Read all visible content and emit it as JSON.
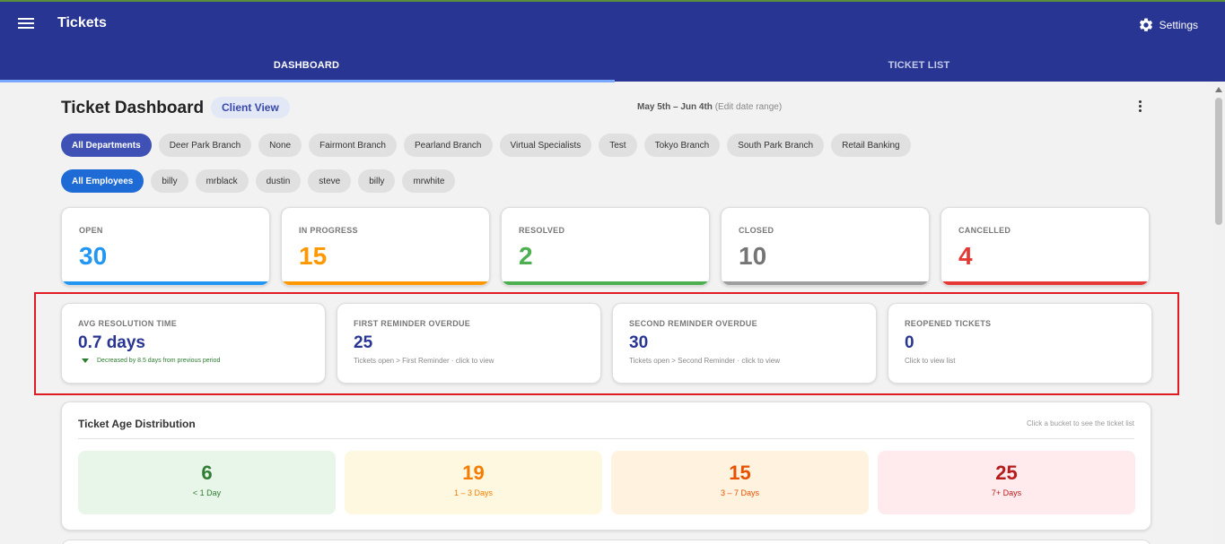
{
  "app": {
    "title": "Tickets",
    "settings_label": "Settings"
  },
  "tabs": [
    {
      "label": "DASHBOARD",
      "active": true
    },
    {
      "label": "TICKET LIST",
      "active": false
    }
  ],
  "header": {
    "title": "Ticket Dashboard",
    "client_view_label": "Client View",
    "date_range": "May 5th – Jun 4th",
    "edit_date_range": "(Edit date range)"
  },
  "departments": [
    {
      "label": "All Departments",
      "selected": true
    },
    {
      "label": "Deer Park Branch"
    },
    {
      "label": "None"
    },
    {
      "label": "Fairmont Branch"
    },
    {
      "label": "Pearland Branch"
    },
    {
      "label": "Virtual Specialists"
    },
    {
      "label": "Test"
    },
    {
      "label": "Tokyo Branch"
    },
    {
      "label": "South Park Branch"
    },
    {
      "label": "Retail Banking"
    }
  ],
  "employees": [
    {
      "label": "All Employees",
      "selected": true
    },
    {
      "label": "billy"
    },
    {
      "label": "mrblack"
    },
    {
      "label": "dustin"
    },
    {
      "label": "steve"
    },
    {
      "label": "billy"
    },
    {
      "label": "mrwhite"
    }
  ],
  "status_cards": [
    {
      "label": "OPEN",
      "value": "30",
      "color": "#2196f3"
    },
    {
      "label": "IN PROGRESS",
      "value": "15",
      "color": "#ff9800"
    },
    {
      "label": "RESOLVED",
      "value": "2",
      "color": "#4caf50"
    },
    {
      "label": "CLOSED",
      "value": "10",
      "color": "#757575"
    },
    {
      "label": "CANCELLED",
      "value": "4",
      "color": "#e53935"
    }
  ],
  "kpis": {
    "avg_resolution": {
      "label": "AVG RESOLUTION TIME",
      "value": "0.7 days",
      "trend": "Decreased by 8.5 days from previous period"
    },
    "first_reminder": {
      "label": "FIRST REMINDER OVERDUE",
      "value": "25",
      "sub": "Tickets open > First Reminder · click to view"
    },
    "second_reminder": {
      "label": "SECOND REMINDER OVERDUE",
      "value": "30",
      "sub": "Tickets open > Second Reminder · click to view"
    },
    "reopened": {
      "label": "REOPENED TICKETS",
      "value": "0",
      "sub": "Click to view list"
    }
  },
  "age_distribution": {
    "title": "Ticket Age Distribution",
    "hint": "Click a bucket to see the ticket list",
    "buckets": [
      {
        "value": "6",
        "label": "< 1 Day",
        "color": "#2e7d32",
        "bg": "#e8f5e9"
      },
      {
        "value": "19",
        "label": "1 – 3 Days",
        "color": "#f57c00",
        "bg": "#fff8e1"
      },
      {
        "value": "15",
        "label": "3 – 7 Days",
        "color": "#e65100",
        "bg": "#fff3e0"
      },
      {
        "value": "25",
        "label": "7+ Days",
        "color": "#b71c1c",
        "bg": "#ffebee"
      }
    ]
  },
  "colors": {
    "primary": "#283593",
    "highlight_box": "#e01b24"
  }
}
